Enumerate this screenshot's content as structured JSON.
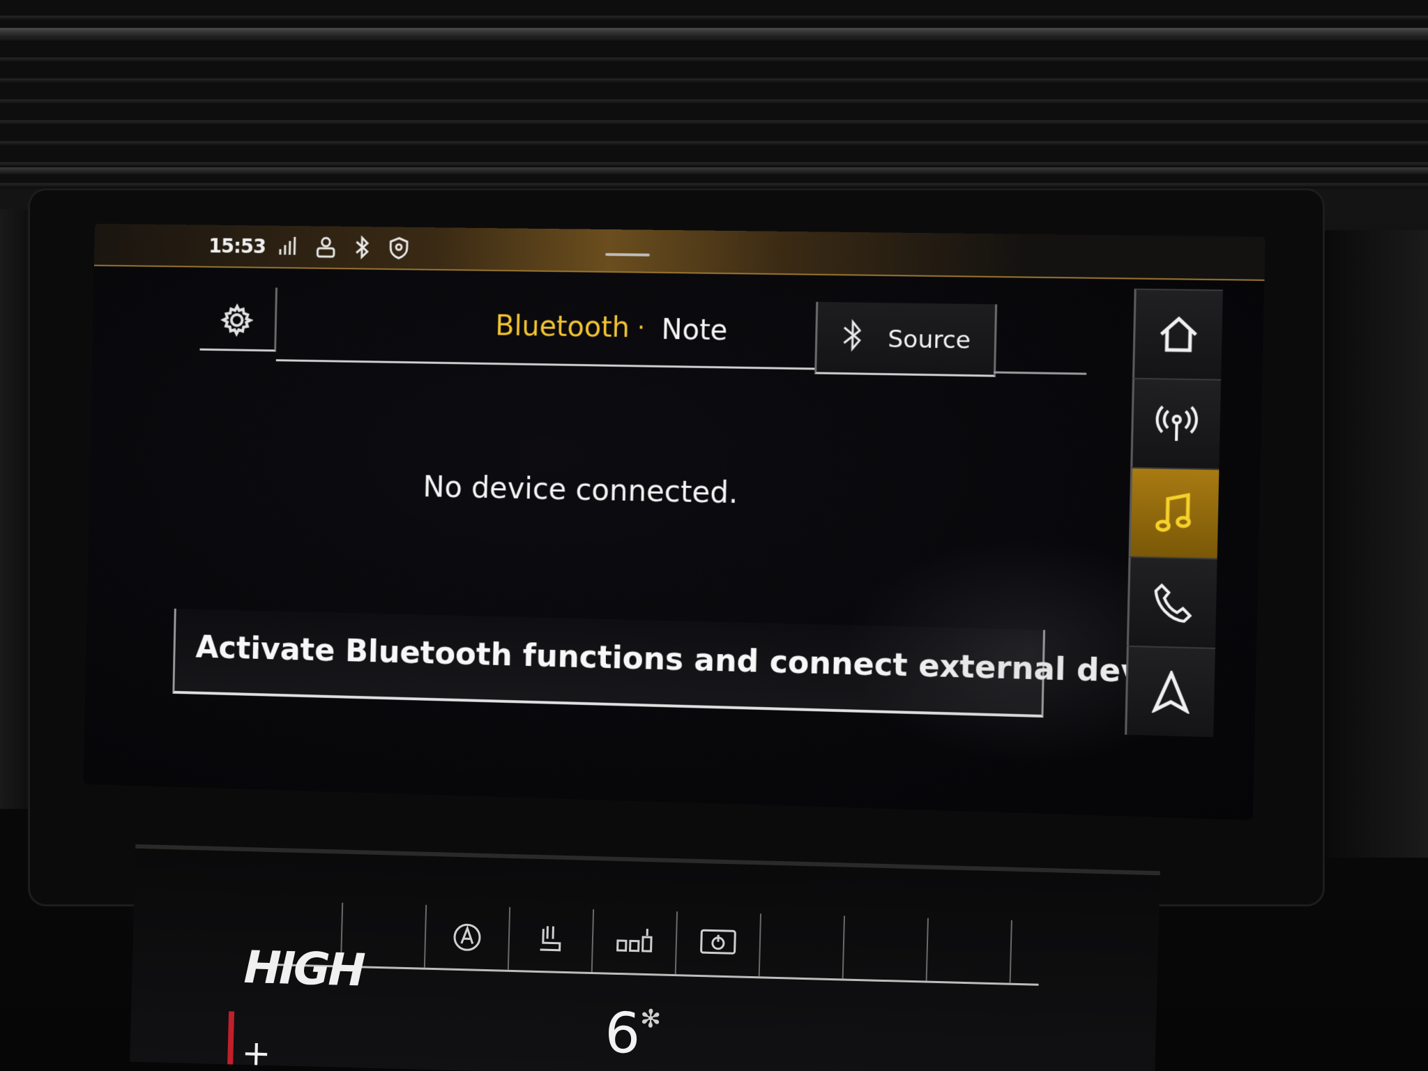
{
  "status_bar": {
    "time": "15:53",
    "icons": [
      "signal-lte-icon",
      "profile-icon",
      "bluetooth-icon",
      "privacy-location-icon"
    ]
  },
  "header": {
    "settings_icon": "gear-icon",
    "title_primary": "Bluetooth",
    "title_separator": "·",
    "title_secondary": "Note",
    "source_label": "Source",
    "source_icon": "bluetooth-icon"
  },
  "main": {
    "message": "No device connected.",
    "hint": "Activate Bluetooth functions and connect external device."
  },
  "side_nav": {
    "items": [
      {
        "name": "home",
        "icon": "home-icon",
        "active": false
      },
      {
        "name": "radio",
        "icon": "radio-antenna-icon",
        "active": false
      },
      {
        "name": "media",
        "icon": "music-note-icon",
        "active": true
      },
      {
        "name": "phone",
        "icon": "phone-icon",
        "active": false
      },
      {
        "name": "navigation",
        "icon": "navigation-arrow-icon",
        "active": false
      }
    ]
  },
  "climate": {
    "fan_label": "HIGH",
    "fan_speed": "6",
    "temp_symbol": "+"
  },
  "colors": {
    "accent": "#f2c432",
    "active_tab": "#a87a12",
    "text": "#f4f4f4"
  }
}
